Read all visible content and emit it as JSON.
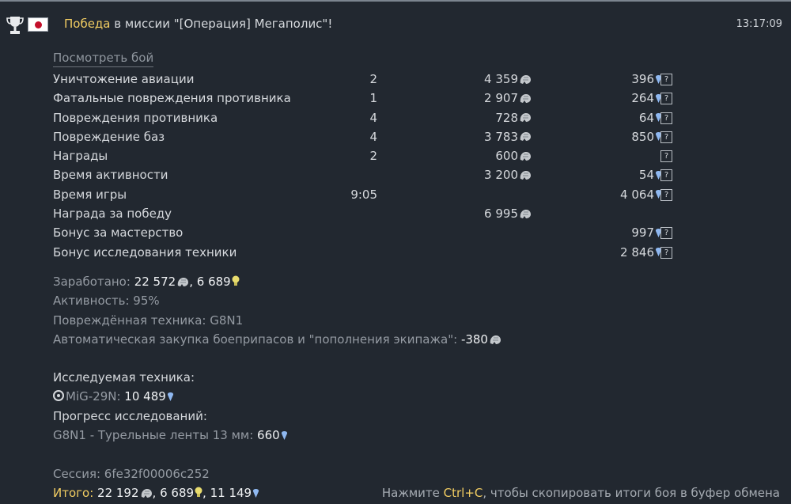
{
  "header": {
    "victory": "Победа",
    "title_rest": "в миссии \"[Операция] Мегаполис\"!",
    "time": "13:17:09",
    "trophy_icon": "trophy-icon",
    "flag_icon": "japan-flag-icon"
  },
  "view_battle": "Посмотреть бой",
  "stats": [
    {
      "name": "Уничтожение авиации",
      "count": "2",
      "sl": "4 359",
      "rp": "396",
      "help": "?"
    },
    {
      "name": "Фатальные повреждения противника",
      "count": "1",
      "sl": "2 907",
      "rp": "264",
      "help": "?"
    },
    {
      "name": "Повреждения противника",
      "count": "4",
      "sl": "728",
      "rp": "64",
      "help": "?"
    },
    {
      "name": "Повреждение баз",
      "count": "4",
      "sl": "3 783",
      "rp": "850",
      "help": "?"
    },
    {
      "name": "Награды",
      "count": "2",
      "sl": "600",
      "rp": "",
      "help": "?"
    },
    {
      "name": "Время активности",
      "count": "",
      "sl": "3 200",
      "rp": "54",
      "help": "?"
    },
    {
      "name": "Время игры",
      "count": "9:05",
      "sl": "",
      "rp": "4 064",
      "help": "?"
    },
    {
      "name": "Награда за победу",
      "count": "",
      "sl": "6 995",
      "rp": "",
      "help": ""
    },
    {
      "name": "Бонус за мастерство",
      "count": "",
      "sl": "",
      "rp": "997",
      "help": "?"
    },
    {
      "name": "Бонус исследования техники",
      "count": "",
      "sl": "",
      "rp": "2 846",
      "help": "?"
    }
  ],
  "earned": {
    "label": "Заработано:",
    "sl": "22 572",
    "sep": ",",
    "crp": "6 689"
  },
  "activity": "Активность: 95%",
  "damaged": "Повреждённая техника: G8N1",
  "autobuy": {
    "label": "Автоматическая закупка боеприпасов и \"пополнения экипажа\":",
    "value": "-380"
  },
  "research": {
    "heading": "Исследуемая техника:",
    "vehicle": "MiG-29N:",
    "vehicle_rp": "10 489",
    "progress_heading": "Прогресс исследований:",
    "progress_label": "G8N1 - Турельные ленты 13 мм:",
    "progress_rp": "660"
  },
  "session": "Сессия: 6fe32f00006c252",
  "total": {
    "label": "Итого:",
    "sl": "22 192",
    "crp": "6 689",
    "rp": "11 149",
    "sep": ","
  },
  "hint": {
    "before": "Нажмите",
    "keys": "Ctrl+C",
    "after": ", чтобы скопировать итоги боя в буфер обмена"
  },
  "colors": {
    "background": "#222830",
    "accent": "#f2cd62",
    "rp_drop": "#8fb8f0",
    "bulb": "#e8dc6e"
  }
}
